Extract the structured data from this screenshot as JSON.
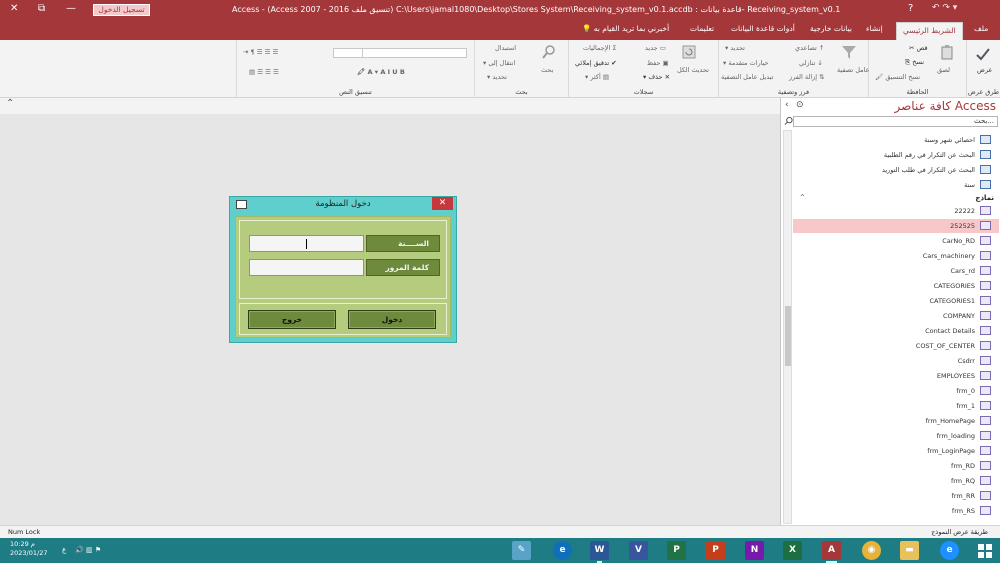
{
  "titlebar": {
    "title": "Access  -  (Access 2007 - 2016 تنسيق ملف) C:\\Users\\jamal1080\\Desktop\\Stores System\\Receiving_system_v0.1.accdb : قاعدة بيانات- Receiving_system_v0.1",
    "signin": "تسجيل الدخول",
    "close": "✕",
    "restore": "⧉",
    "minimize": "—",
    "help": "?",
    "qat": "↶  ↷  ▾"
  },
  "tabs": {
    "file": "ملف",
    "home": "الشريط الرئيسي",
    "create": "إنشاء",
    "external": "بيانات خارجية",
    "dbtools": "أدوات قاعدة البيانات",
    "help": "تعليمات",
    "tellme": "أخبرني بما تريد القيام به"
  },
  "ribbon": {
    "views": {
      "view": "عرض",
      "label": "طرق عرض"
    },
    "clipboard": {
      "paste": "لصق",
      "cut": "قص",
      "copy": "نسخ",
      "format_painter": "نسخ التنسيق",
      "label": "الحافظة"
    },
    "sort_filter": {
      "filter": "عامل تصفية",
      "ascending": "تصاعدي",
      "descending": "تنازلي",
      "remove_sort": "إزالة الفرز",
      "selection": "تحديد",
      "advanced": "خيارات متقدمة",
      "toggle_filter": "تبديل عامل التصفية",
      "label": "فرز وتصفية"
    },
    "records": {
      "refresh": "تحديث الكل",
      "new": "جديد",
      "save": "حفظ",
      "delete": "حذف",
      "totals": "الإجماليات",
      "spelling": "تدقيق إملائي",
      "more": "أكثر",
      "label": "سجلات"
    },
    "find": {
      "find": "بحث",
      "replace": "استبدال",
      "goto": "انتقال إلى",
      "select": "تحديد",
      "label": "بحث"
    },
    "text_formatting": {
      "label": "تنسيق النص"
    }
  },
  "nav": {
    "title": "كافة عناصر Access",
    "search_placeholder": "بحث...",
    "queries": [
      {
        "label": "احصائي شهر وسنة"
      },
      {
        "label": "البحث عن التكرار في رقم الطلبية"
      },
      {
        "label": "البحث عن التكرار في طلب التوريد"
      },
      {
        "label": "سنة"
      }
    ],
    "forms_section": "نماذج",
    "forms": [
      {
        "label": "22222"
      },
      {
        "label": "252525"
      },
      {
        "label": "CarNo_RD"
      },
      {
        "label": "Cars_machinery"
      },
      {
        "label": "Cars_rd"
      },
      {
        "label": "CATEGORIES"
      },
      {
        "label": "CATEGORIES1"
      },
      {
        "label": "COMPANY"
      },
      {
        "label": "Contact Details"
      },
      {
        "label": "COST_OF_CENTER"
      },
      {
        "label": "Csdrr"
      },
      {
        "label": "EMPLOYEES"
      },
      {
        "label": "frm_0"
      },
      {
        "label": "frm_1"
      },
      {
        "label": "frm_HomePage"
      },
      {
        "label": "frm_loading"
      },
      {
        "label": "frm_LoginPage"
      },
      {
        "label": "frm_RD"
      },
      {
        "label": "frm_RQ"
      },
      {
        "label": "frm_RR"
      },
      {
        "label": "frm_RS"
      }
    ]
  },
  "dialog": {
    "title": "دخول المنظومة",
    "year_label": "الســــنة",
    "password_label": "كلمة المرور",
    "login_button": "دخول",
    "exit_button": "خروج"
  },
  "status": {
    "left": "Num Lock",
    "right": "طريقة عرض النموذج"
  },
  "taskbar": {
    "time": "10:29 م",
    "date": "2023/01/27",
    "lang": "ع"
  },
  "colors": {
    "access_red": "#a4373a",
    "dialog_teal": "#5ecfcc",
    "dialog_green": "#b5cc7e",
    "label_olive": "#6e8a3c",
    "taskbar": "#1e7d84"
  }
}
